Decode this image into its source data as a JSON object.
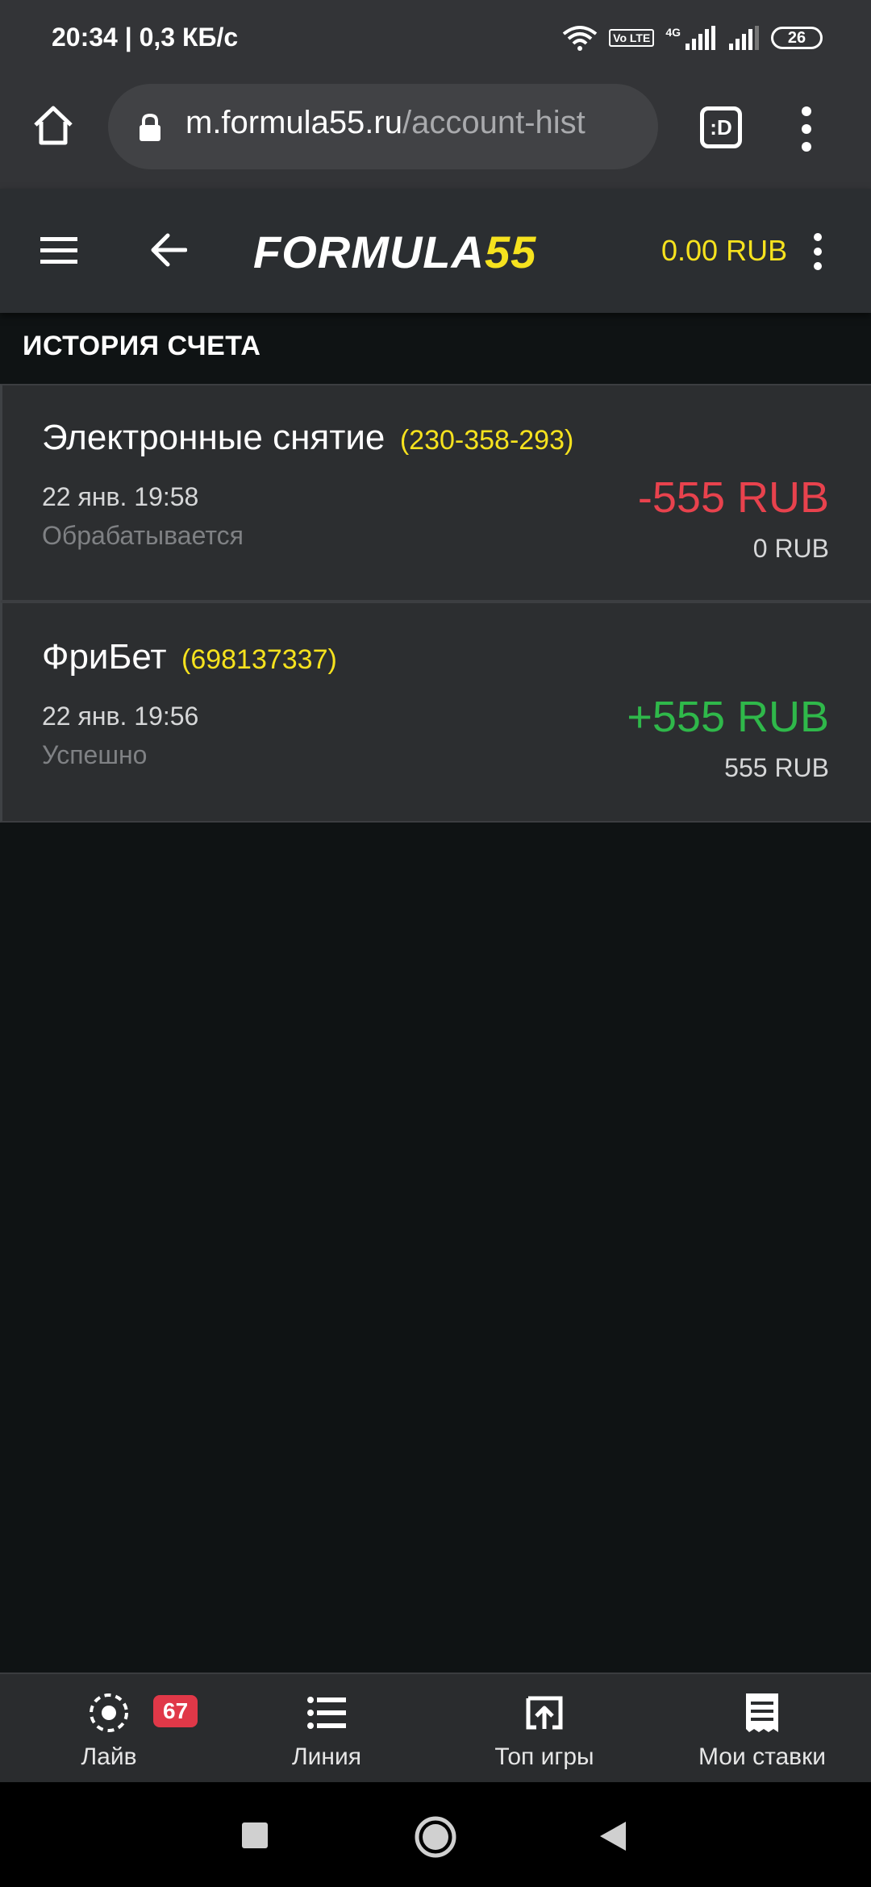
{
  "status_bar": {
    "time_speed": "20:34 | 0,3 КБ/с",
    "volte_label": "Vo LTE",
    "network_label": "4G",
    "battery_level": "26"
  },
  "browser": {
    "url_host": "m.formula55.ru",
    "url_path": "/account-hist",
    "tabs_label": ":D"
  },
  "header": {
    "logo_white": "FORMULA",
    "logo_yellow": "55",
    "balance": "0.00 RUB"
  },
  "section_title": "ИСТОРИЯ СЧЕТА",
  "transactions": [
    {
      "title": "Электронные снятие",
      "id": "(230-358-293)",
      "date": "22 янв. 19:58",
      "status": "Обрабатывается",
      "amount": "-555 RUB",
      "balance_after": "0 RUB",
      "amount_color": "#e8424d"
    },
    {
      "title": "ФриБет",
      "id": "(698137337)",
      "date": "22 янв. 19:56",
      "status": "Успешно",
      "amount": "+555 RUB",
      "balance_after": "555 RUB",
      "amount_color": "#2fb84a"
    }
  ],
  "bottom_nav": {
    "items": [
      {
        "label": "Лайв",
        "icon": "live-icon",
        "badge": "67"
      },
      {
        "label": "Линия",
        "icon": "list-icon"
      },
      {
        "label": "Топ игры",
        "icon": "top-games-icon"
      },
      {
        "label": "Мои ставки",
        "icon": "receipt-icon"
      }
    ]
  },
  "colors": {
    "accent_yellow": "#f6e21e",
    "negative": "#e8424d",
    "positive": "#2fb84a",
    "badge": "#e03848"
  }
}
